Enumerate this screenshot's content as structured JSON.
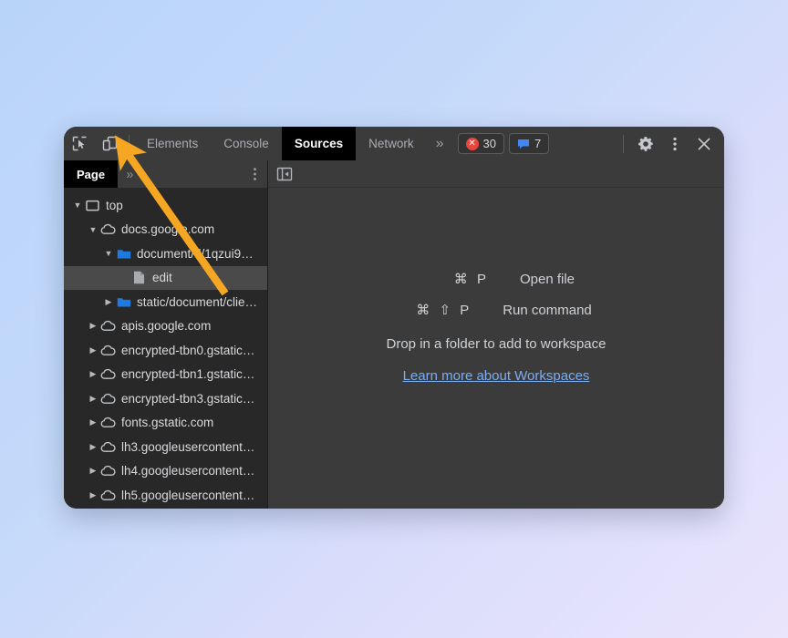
{
  "window": {
    "toolbar": {
      "inspect_icon": "inspect-cursor-icon",
      "device_icon": "device-toolbar-icon",
      "tabs": [
        {
          "label": "Elements",
          "active": false
        },
        {
          "label": "Console",
          "active": false
        },
        {
          "label": "Sources",
          "active": true
        },
        {
          "label": "Network",
          "active": false
        }
      ],
      "overflow_label": "»",
      "error_badge": {
        "icon": "error-circle-icon",
        "count": "30"
      },
      "message_badge": {
        "icon": "message-icon",
        "count": "7"
      },
      "settings_icon": "gear-icon",
      "more_icon": "vertical-dots-icon",
      "close_icon": "close-icon"
    },
    "navigator": {
      "tab_label": "Page",
      "overflow_label": "»",
      "menu_icon": "vertical-dots-icon",
      "tree": [
        {
          "label": "top",
          "icon": "frame-icon",
          "depth": 0,
          "twisty": "down",
          "selected": false
        },
        {
          "label": "docs.google.com",
          "icon": "cloud-icon",
          "depth": 1,
          "twisty": "down",
          "selected": false
        },
        {
          "label": "document/d/1qzui9…",
          "icon": "folder-icon",
          "depth": 2,
          "twisty": "down",
          "selected": false
        },
        {
          "label": "edit",
          "icon": "file-icon",
          "depth": 3,
          "twisty": "none",
          "selected": true
        },
        {
          "label": "static/document/clie…",
          "icon": "folder-icon",
          "depth": 2,
          "twisty": "right",
          "selected": false
        },
        {
          "label": "apis.google.com",
          "icon": "cloud-icon",
          "depth": 1,
          "twisty": "right",
          "selected": false
        },
        {
          "label": "encrypted-tbn0.gstatic…",
          "icon": "cloud-icon",
          "depth": 1,
          "twisty": "right",
          "selected": false
        },
        {
          "label": "encrypted-tbn1.gstatic…",
          "icon": "cloud-icon",
          "depth": 1,
          "twisty": "right",
          "selected": false
        },
        {
          "label": "encrypted-tbn3.gstatic…",
          "icon": "cloud-icon",
          "depth": 1,
          "twisty": "right",
          "selected": false
        },
        {
          "label": "fonts.gstatic.com",
          "icon": "cloud-icon",
          "depth": 1,
          "twisty": "right",
          "selected": false
        },
        {
          "label": "lh3.googleusercontent…",
          "icon": "cloud-icon",
          "depth": 1,
          "twisty": "right",
          "selected": false
        },
        {
          "label": "lh4.googleusercontent…",
          "icon": "cloud-icon",
          "depth": 1,
          "twisty": "right",
          "selected": false
        },
        {
          "label": "lh5.googleusercontent…",
          "icon": "cloud-icon",
          "depth": 1,
          "twisty": "right",
          "selected": false
        }
      ]
    },
    "content": {
      "collapse_icon": "collapse-sidebar-icon",
      "shortcuts": [
        {
          "keys": "⌘ P",
          "action": "Open file"
        },
        {
          "keys": "⌘ ⇧ P",
          "action": "Run command"
        }
      ],
      "drop_hint": "Drop in a folder to add to workspace",
      "link_label": "Learn more about Workspaces"
    }
  },
  "annotation": {
    "type": "arrow",
    "color": "#F5A623",
    "points_to": "device-toolbar-icon"
  },
  "colors": {
    "toolbar_bg": "#3b3b3b",
    "sidebar_bg": "#282828",
    "active_tab_bg": "#000000",
    "selected_row_bg": "#4a4a4a",
    "link": "#7cadf0",
    "error_red": "#e8453c",
    "message_blue": "#4285f4",
    "folder_blue": "#1f7ae0",
    "arrow_orange": "#F5A623"
  }
}
